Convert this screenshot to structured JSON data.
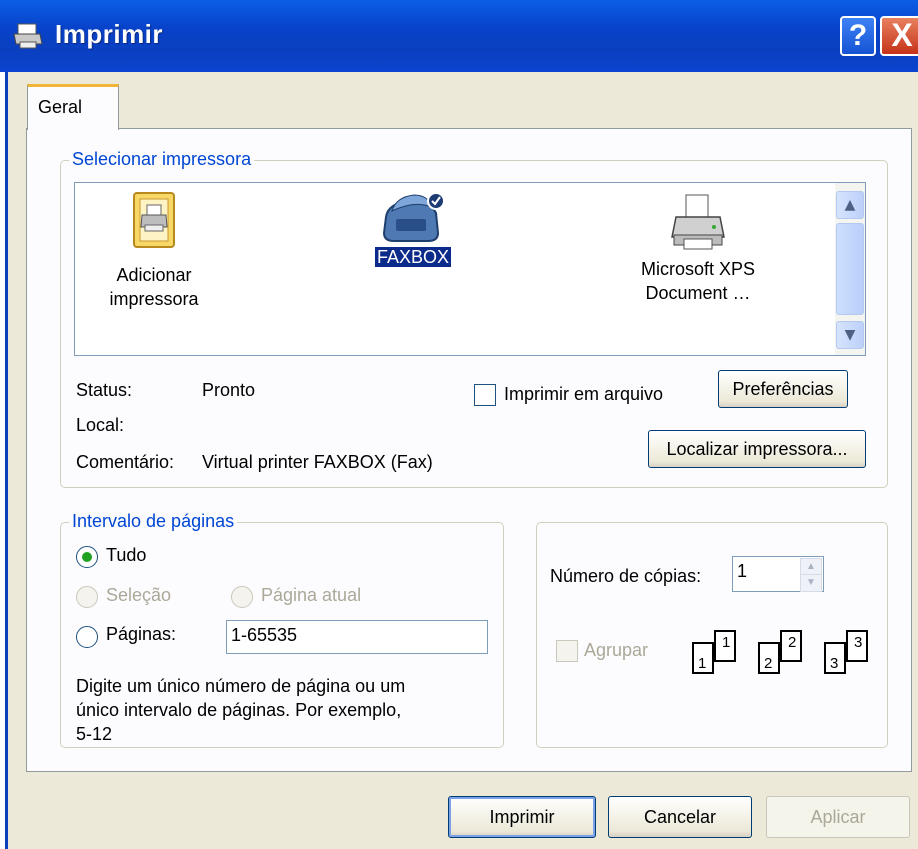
{
  "window": {
    "title": "Imprimir",
    "help_glyph": "?",
    "close_glyph": "X"
  },
  "tabs": [
    {
      "label": "Geral",
      "active": true
    }
  ],
  "select_printer": {
    "legend": "Selecionar impressora",
    "printers": [
      {
        "label_line1": "Adicionar",
        "label_line2": "impressora",
        "icon": "add-printer-icon",
        "selected": false
      },
      {
        "label_line1": "FAXBOX",
        "label_line2": "",
        "icon": "fax-icon",
        "selected": true,
        "default": true
      },
      {
        "label_line1": "Microsoft XPS",
        "label_line2": "Document …",
        "icon": "printer-icon",
        "selected": false
      }
    ],
    "status_label": "Status:",
    "status_value": "Pronto",
    "location_label": "Local:",
    "location_value": "",
    "comment_label": "Comentário:",
    "comment_value": "Virtual printer FAXBOX (Fax)",
    "print_to_file_label": "Imprimir em arquivo",
    "print_to_file_checked": false,
    "preferences_button": "Preferências",
    "find_printer_button": "Localizar impressora..."
  },
  "page_range": {
    "legend": "Intervalo de páginas",
    "all_label": "Tudo",
    "selection_label": "Seleção",
    "current_page_label": "Página atual",
    "pages_label": "Páginas:",
    "pages_value": "1-65535",
    "selected_option": "all",
    "hint_line1": "Digite um único número de página ou um",
    "hint_line2": "único intervalo de páginas. Por exemplo,",
    "hint_line3": "5-12"
  },
  "copies": {
    "label": "Número de cópias:",
    "value": "1",
    "collate_label": "Agrupar",
    "collate_checked": false,
    "collate_pages": [
      "1",
      "1",
      "2",
      "2",
      "3",
      "3"
    ]
  },
  "buttons": {
    "print": "Imprimir",
    "cancel": "Cancelar",
    "apply": "Aplicar"
  },
  "colors": {
    "titlebar": "#0842c9",
    "dialog_bg": "#ece9d8",
    "legend_text": "#0046d5",
    "selected_label_bg": "#0b2a8a",
    "radio_dot": "#21a121"
  }
}
